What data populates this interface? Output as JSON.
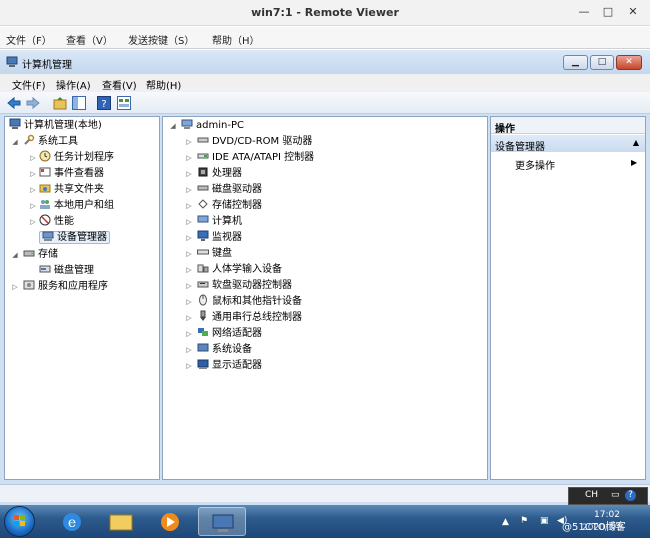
{
  "viewer": {
    "title": "win7:1 - Remote Viewer",
    "controls": [
      "—",
      "□",
      "✕"
    ],
    "menu": [
      "文件（F）",
      "查看（V）",
      "发送按键（S）",
      "帮助（H）"
    ]
  },
  "mmc": {
    "title": "计算机管理",
    "menu": [
      "文件(F)",
      "操作(A)",
      "查看(V)",
      "帮助(H)"
    ],
    "tree": {
      "root": "计算机管理(本地)",
      "system_tools": "系统工具",
      "items": [
        "任务计划程序",
        "事件查看器",
        "共享文件夹",
        "本地用户和组",
        "性能",
        "设备管理器"
      ],
      "storage": "存储",
      "disk_mgmt": "磁盘管理",
      "services": "服务和应用程序"
    },
    "devices": {
      "root": "admin-PC",
      "items": [
        "DVD/CD-ROM 驱动器",
        "IDE ATA/ATAPI 控制器",
        "处理器",
        "磁盘驱动器",
        "存储控制器",
        "计算机",
        "监视器",
        "键盘",
        "人体学输入设备",
        "软盘驱动器控制器",
        "鼠标和其他指针设备",
        "通用串行总线控制器",
        "网络适配器",
        "系统设备",
        "显示适配器"
      ]
    },
    "actions": {
      "header": "操作",
      "section": "设备管理器",
      "more": "更多操作"
    }
  },
  "taskbar": {
    "lang": "CH",
    "time": "17:02",
    "date": "2020/3/5",
    "watermark": "@51CTO博客"
  }
}
